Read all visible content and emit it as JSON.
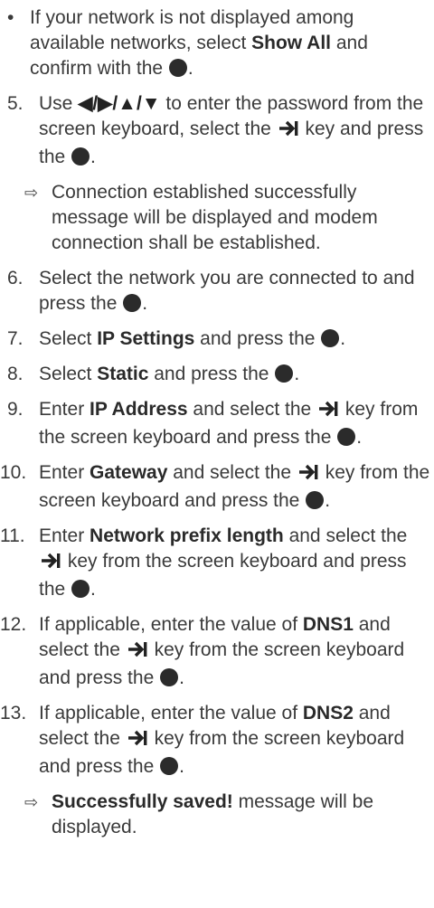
{
  "intro_bullet": {
    "marker": "•",
    "text_a": "If your network is not displayed among available networks, select ",
    "bold": "Show All",
    "text_b": " and confirm with the ",
    "end": "."
  },
  "steps": {
    "s5": {
      "num": "5.",
      "text_a": "Use ",
      "arrows": "◀/▶/▲/▼",
      "text_b": " to enter the password from the screen keyboard, select the ",
      "text_c": " key and press the ",
      "end": "."
    },
    "r5": {
      "marker": "⇨",
      "text": "Connection established successfully message will be displayed and modem connection shall be established."
    },
    "s6": {
      "num": "6.",
      "text_a": "Select the network you are connected to and press the ",
      "end": "."
    },
    "s7": {
      "num": "7.",
      "text_a": "Select ",
      "bold": "IP Settings",
      "text_b": " and press the ",
      "end": "."
    },
    "s8": {
      "num": "8.",
      "text_a": "Select ",
      "bold": "Static",
      "text_b": " and press the ",
      "end": "."
    },
    "s9": {
      "num": "9.",
      "text_a": "Enter ",
      "bold": "IP Address",
      "text_b": " and select the ",
      "text_c": " key from the screen keyboard and press the ",
      "end": "."
    },
    "s10": {
      "num": "10.",
      "text_a": "Enter ",
      "bold": "Gateway",
      "text_b": " and select the ",
      "text_c": " key from the screen keyboard and press the ",
      "end": "."
    },
    "s11": {
      "num": "11.",
      "text_a": "Enter ",
      "bold": "Network prefix length",
      "text_b": " and select the ",
      "text_c": " key from the screen keyboard and press the ",
      "end": "."
    },
    "s12": {
      "num": "12.",
      "text_a": "If applicable, enter the value of ",
      "bold": "DNS1",
      "text_b": " and select the ",
      "text_c": " key from the screen keyboard and press the ",
      "end": "."
    },
    "s13": {
      "num": "13.",
      "text_a": "If applicable, enter the value of ",
      "bold": "DNS2",
      "text_b": " and select the ",
      "text_c": " key from the screen keyboard and press the ",
      "end": "."
    },
    "r13": {
      "marker": "⇨",
      "bold": "Successfully saved!",
      "text": " message will be displayed."
    }
  },
  "icons": {
    "ok": "ok-button-circle-icon",
    "tab": "tab-key-arrow-icon"
  }
}
